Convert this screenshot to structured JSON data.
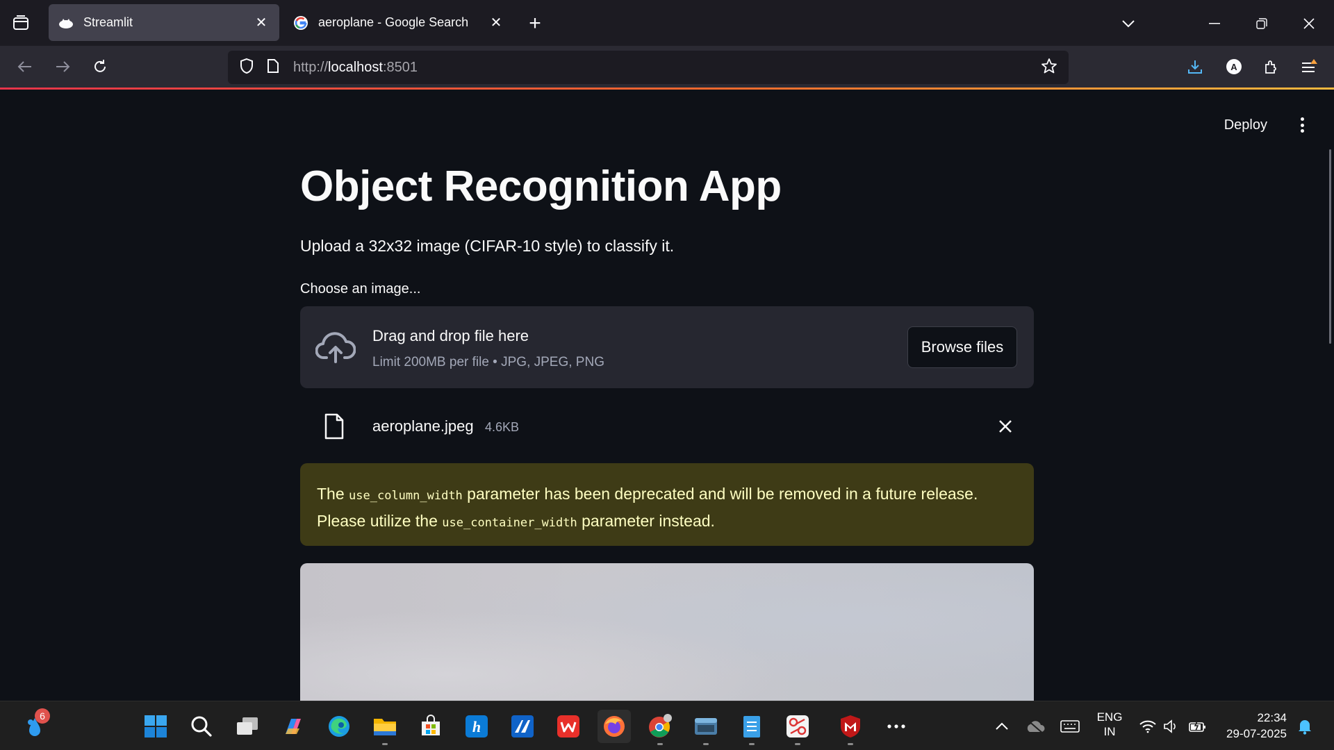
{
  "browser": {
    "tabs": [
      {
        "title": "Streamlit",
        "active": true
      },
      {
        "title": "aeroplane - Google Search",
        "active": false
      }
    ],
    "url_prefix": "http://",
    "url_host": "localhost",
    "url_port": ":8501"
  },
  "app": {
    "deploy_label": "Deploy",
    "title": "Object Recognition App",
    "subtitle": "Upload a 32x32 image (CIFAR-10 style) to classify it.",
    "uploader": {
      "label": "Choose an image...",
      "drag_text": "Drag and drop file here",
      "limit_text": "Limit 200MB per file • JPG, JPEG, PNG",
      "browse_label": "Browse files"
    },
    "uploaded_file": {
      "name": "aeroplane.jpeg",
      "size": "4.6KB"
    },
    "warning": {
      "part1": "The ",
      "code1": "use_column_width",
      "part2": " parameter has been deprecated and will be removed in a future release. Please utilize the ",
      "code2": "use_container_width",
      "part3": " parameter instead."
    }
  },
  "taskbar": {
    "widget_badge": "6",
    "language_line1": "ENG",
    "language_line2": "IN",
    "time": "22:34",
    "date": "29-07-2025"
  },
  "colors": {
    "accent_line": [
      "#e6344a",
      "#f26a2d",
      "#f9b93f"
    ],
    "warning_bg": "#3e3b16",
    "warning_text": "#ffffc2"
  }
}
